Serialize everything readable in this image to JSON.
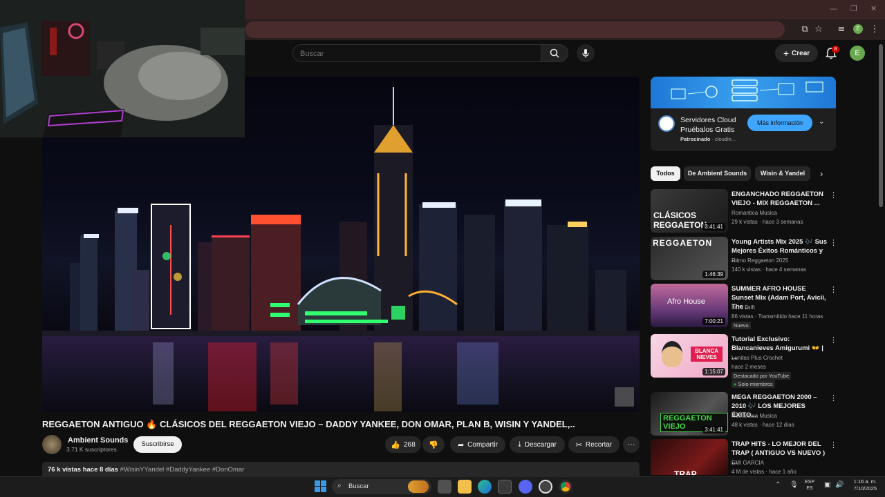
{
  "header": {
    "search_placeholder": "Buscar",
    "create_label": "Crear",
    "notifications_count": "8",
    "avatar_letter": "E",
    "browser_avatar_letter": "E"
  },
  "video": {
    "title": "REGGAETON ANTIGUO 🔥 CLÁSICOS DEL REGGAETON VIEJO – DADDY YANKEE, DON OMAR, PLAN B, WISIN Y YANDEL,..",
    "channel_name": "Ambient Sounds",
    "subscribers": "3.71 K suscriptores",
    "subscribe_label": "Suscribirse",
    "likes": "268",
    "share_label": "Compartir",
    "download_label": "Descargar",
    "clip_label": "Recortar",
    "views_date": "76 k vistas  hace 8 días",
    "hashtags": "#WisinYYandel #DaddyYankee #DonOmar"
  },
  "ad": {
    "title_line1": "Servidores Cloud",
    "title_line2": "Pruébalos Gratis",
    "sponsored": "Patrocinado",
    "advertiser": "cloudin...",
    "cta_label": "Más información"
  },
  "chips": [
    "Todos",
    "De Ambient Sounds",
    "Wisin & Yandel"
  ],
  "recommendations": [
    {
      "title": "ENGANCHADO REGGAETON VIEJO - MIX REGGAETON ...",
      "channel": "Romantica Musica",
      "meta": "29 k vistas · hace 3 semanas",
      "duration": "3:41:41",
      "thumb_text": "CLÁSICOS REGGAETON"
    },
    {
      "title": "Young Artists Mix 2025 🎶 Sus Mejores Éxitos Románticos y ...",
      "channel": "Ritmo Reggaeton 2025",
      "meta": "140 k vistas · hace 4 semanas",
      "duration": "1:46:39",
      "thumb_text": "REGGAETON"
    },
    {
      "title": "SUMMER AFRO HOUSE Sunset Mix (Adam Port, Avicii, The ...",
      "channel": "Ibiza Drift",
      "meta": "86 vistas · Transmitido hace 11 horas",
      "duration": "7:00:21",
      "badge": "Nuevo",
      "thumb_text": "Afro House"
    },
    {
      "title": "Tutorial Exclusivo: Blancanieves Amigurumi 👐 | ...",
      "channel": "Lunitas Plus Crochet",
      "meta": "hace 2 meses",
      "duration": "1:15:07",
      "badge": "Destacado por YouTube",
      "members": "Solo miembros",
      "thumb_text": "BLANCA NIEVES"
    },
    {
      "title": "MEGA REGGAETON 2000 – 2010 🎶 LOS MEJORES ÉXITO...",
      "channel": "Romantica Musica",
      "meta": "48 k vistas · hace 12 días",
      "duration": "3:41:41",
      "thumb_text": "REGGAETON VIEJO"
    },
    {
      "title": "TRAP HITS - LO MEJOR DEL TRAP ( ANTIGUO VS NUEVO ) ...",
      "channel": "EMI GARCIA",
      "meta": "4 M de vistas · hace 1 año",
      "duration": "",
      "thumb_text": "TRAP"
    }
  ],
  "taskbar": {
    "search_label": "Buscar",
    "lang_top": "ESP",
    "lang_bottom": "ES",
    "time": "1:16 a. m.",
    "date": "7/10/2025"
  },
  "colors": {
    "bg": "#0f0f0f",
    "surface": "#272727",
    "accent_blue": "#3ea6ff",
    "yt_red": "#cc0000"
  }
}
